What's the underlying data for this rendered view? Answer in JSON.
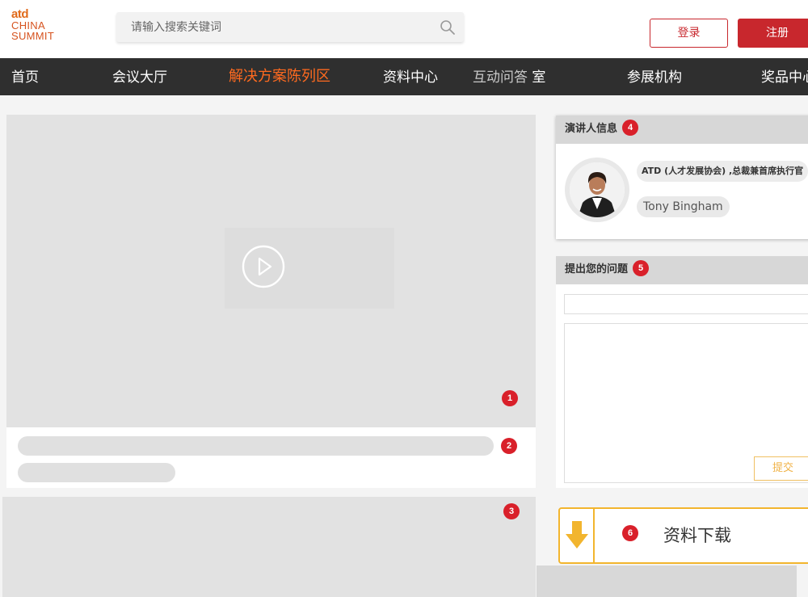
{
  "logo": {
    "line1": "atd",
    "line2": "CHINA",
    "line3": "SUMMIT"
  },
  "search": {
    "placeholder": "请输入搜索关键词"
  },
  "auth": {
    "login": "登录",
    "register": "注册"
  },
  "nav": {
    "items": [
      "首页",
      "会议大厅",
      "解决方案陈列区",
      "资料中心",
      "互动问答",
      "室",
      "参展机构",
      "奖品中心"
    ],
    "active_index": 2
  },
  "badges": {
    "b1": "1",
    "b2": "2",
    "b3": "3",
    "b4": "4",
    "b5": "5",
    "b6": "6"
  },
  "speaker": {
    "heading": "演讲人信息",
    "title": "ATD (人才发展协会) ,总裁兼首席执行官",
    "name": "Tony Bingham"
  },
  "question": {
    "heading": "提出您的问题",
    "submit": "提交"
  },
  "download": {
    "label": "资料下载"
  },
  "colors": {
    "accent_red": "#c8272d",
    "nav_active": "#ff6a1f",
    "nav_bg": "#2f2f2f",
    "download_border": "#f2b52e",
    "badge_red": "#d9202a"
  }
}
